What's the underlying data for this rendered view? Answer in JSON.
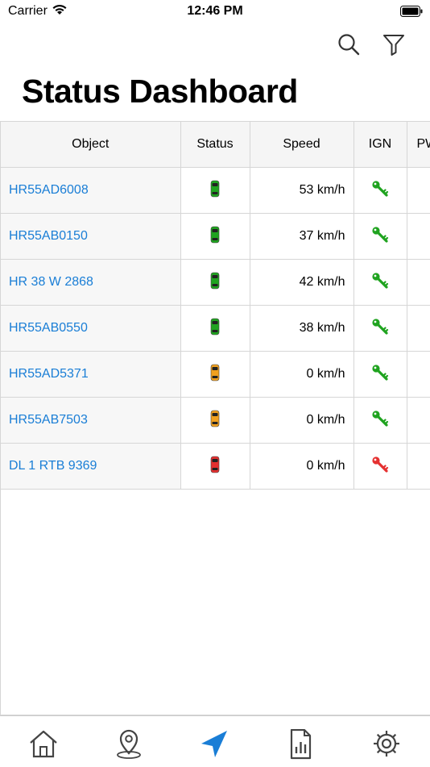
{
  "status_bar": {
    "carrier": "Carrier",
    "time": "12:46 PM"
  },
  "header": {
    "title": "Status Dashboard",
    "search_icon": "search-icon",
    "filter_icon": "filter-icon"
  },
  "table": {
    "columns": [
      "Object",
      "Status",
      "Speed",
      "IGN",
      "PW"
    ],
    "rows": [
      {
        "object": "HR55AD6008",
        "status": "green",
        "speed": "53 km/h",
        "ign": "green"
      },
      {
        "object": "HR55AB0150",
        "status": "green",
        "speed": "37 km/h",
        "ign": "green"
      },
      {
        "object": "HR 38 W 2868",
        "status": "green",
        "speed": "42 km/h",
        "ign": "green"
      },
      {
        "object": "HR55AB0550",
        "status": "green",
        "speed": "38 km/h",
        "ign": "green"
      },
      {
        "object": "HR55AD5371",
        "status": "orange",
        "speed": "0 km/h",
        "ign": "green"
      },
      {
        "object": "HR55AB7503",
        "status": "orange",
        "speed": "0 km/h",
        "ign": "green"
      },
      {
        "object": "DL 1 RTB 9369",
        "status": "red",
        "speed": "0 km/h",
        "ign": "red"
      }
    ]
  },
  "colors": {
    "green": "#1fa31f",
    "orange": "#f0a020",
    "red": "#e53030",
    "link": "#1a7ed6",
    "active_tab": "#1a7ed6",
    "inactive_tab": "#444444"
  },
  "tab_bar": {
    "active": "navigation",
    "tabs": [
      "home-icon",
      "map-pin-icon",
      "navigation-arrow-icon",
      "report-icon",
      "settings-icon"
    ]
  }
}
